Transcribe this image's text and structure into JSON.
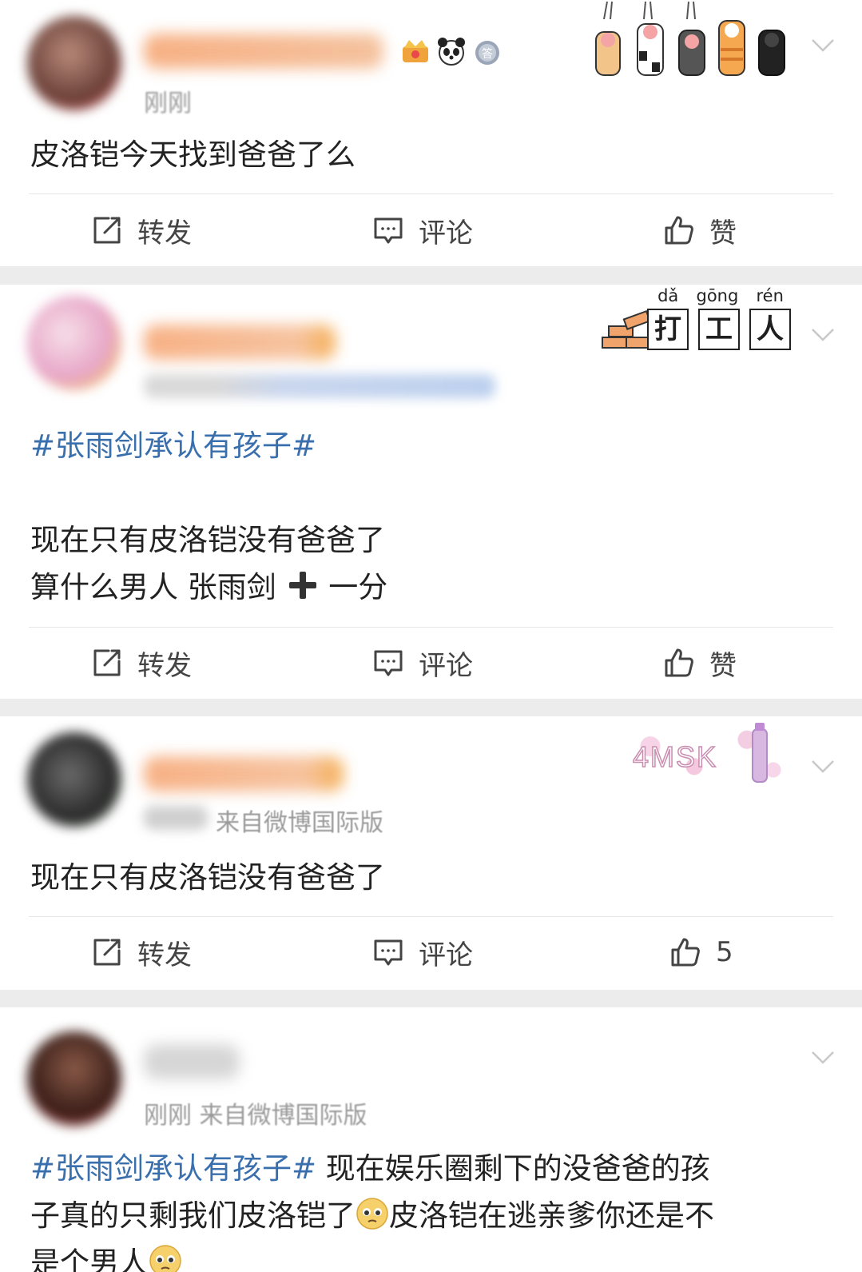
{
  "posts": [
    {
      "meta": "刚刚",
      "content": "皮洛铠今天找到爸爸了么",
      "decoration": "paws",
      "actions": {
        "repost": "转发",
        "comment": "评论",
        "like": "赞"
      }
    },
    {
      "topic": "#张雨剑承认有孩子#",
      "line1": "现在只有皮洛铠没有爸爸了",
      "line2": "算什么男人 张雨剑",
      "line2_suffix": "一分",
      "decoration": {
        "pinyin": [
          "dǎ",
          "gōng",
          "rén"
        ],
        "chars": [
          "打",
          "工",
          "人"
        ]
      },
      "actions": {
        "repost": "转发",
        "comment": "评论",
        "like": "赞"
      }
    },
    {
      "meta": "来自微博国际版",
      "content": "现在只有皮洛铠没有爸爸了",
      "decoration": {
        "text": "4MSK"
      },
      "actions": {
        "repost": "转发",
        "comment": "评论",
        "like": "5"
      }
    },
    {
      "meta": "刚刚  来自微博国际版",
      "topic": "#张雨剑承认有孩子#",
      "text1": " 现在娱乐圈剩下的没爸爸的孩",
      "text2": "子真的只剩我们皮洛铠了",
      "text3": "皮洛铠在逃亲爹你还是不",
      "text4": "是个男人"
    }
  ],
  "colors": {
    "topic": "#3a6fae",
    "text": "#222222",
    "meta": "#9a9a9a",
    "separator": "#ececec",
    "username_orange": "#f5a06a"
  }
}
